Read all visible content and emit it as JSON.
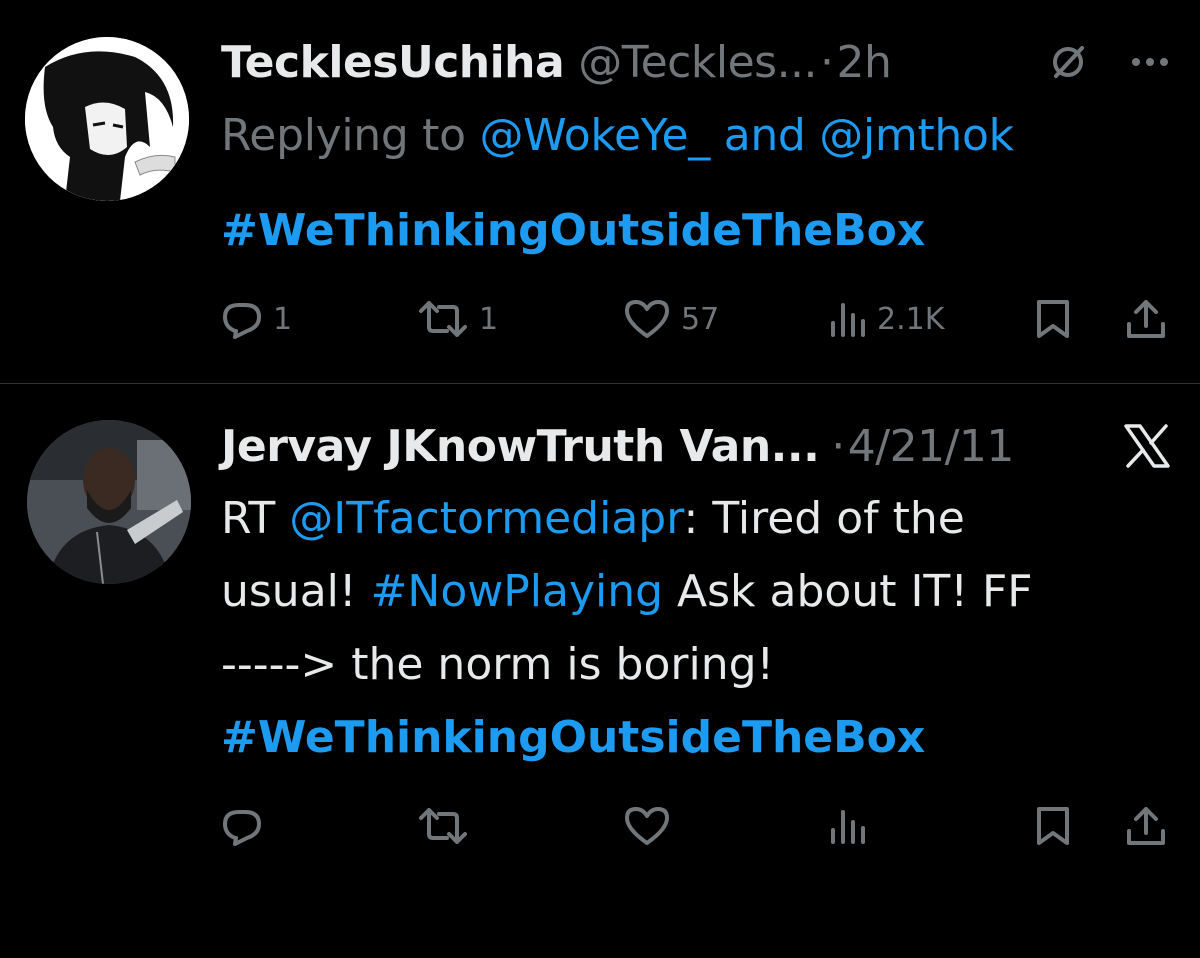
{
  "tweets": [
    {
      "display_name": "TecklesUchiha",
      "handle": "@Teckles...",
      "dot": "·",
      "time": "2h",
      "reply_prefix": "Replying to",
      "reply_mention_1": "@WokeYe_",
      "reply_and": "and",
      "reply_mention_2": "@jmthok",
      "text_hashtag": "#WeThinkingOutsideTheBox",
      "counts": {
        "replies": "1",
        "retweets": "1",
        "likes": "57",
        "views": "2.1K"
      },
      "icons": [
        "grok-icon",
        "more-icon"
      ]
    },
    {
      "display_name": "Jervay JKnowTruth Van...",
      "dot": "·",
      "time": "4/21/11",
      "text": {
        "rt": "RT",
        "mention": "@ITfactormediapr",
        "after_mention": ": Tired of the",
        "line2_start": "usual!",
        "hashtag": "#NowPlaying",
        "line2_end": "Ask about IT! FF",
        "line3": "-----> the norm is boring!",
        "hashtag_final": "#WeThinkingOutsideTheBox"
      },
      "icons": [
        "x-logo-icon"
      ]
    }
  ],
  "colors": {
    "background": "#000000",
    "text": "#e7e9ea",
    "secondary": "#71767b",
    "link": "#1d9bf0",
    "divider": "#2f3336"
  }
}
